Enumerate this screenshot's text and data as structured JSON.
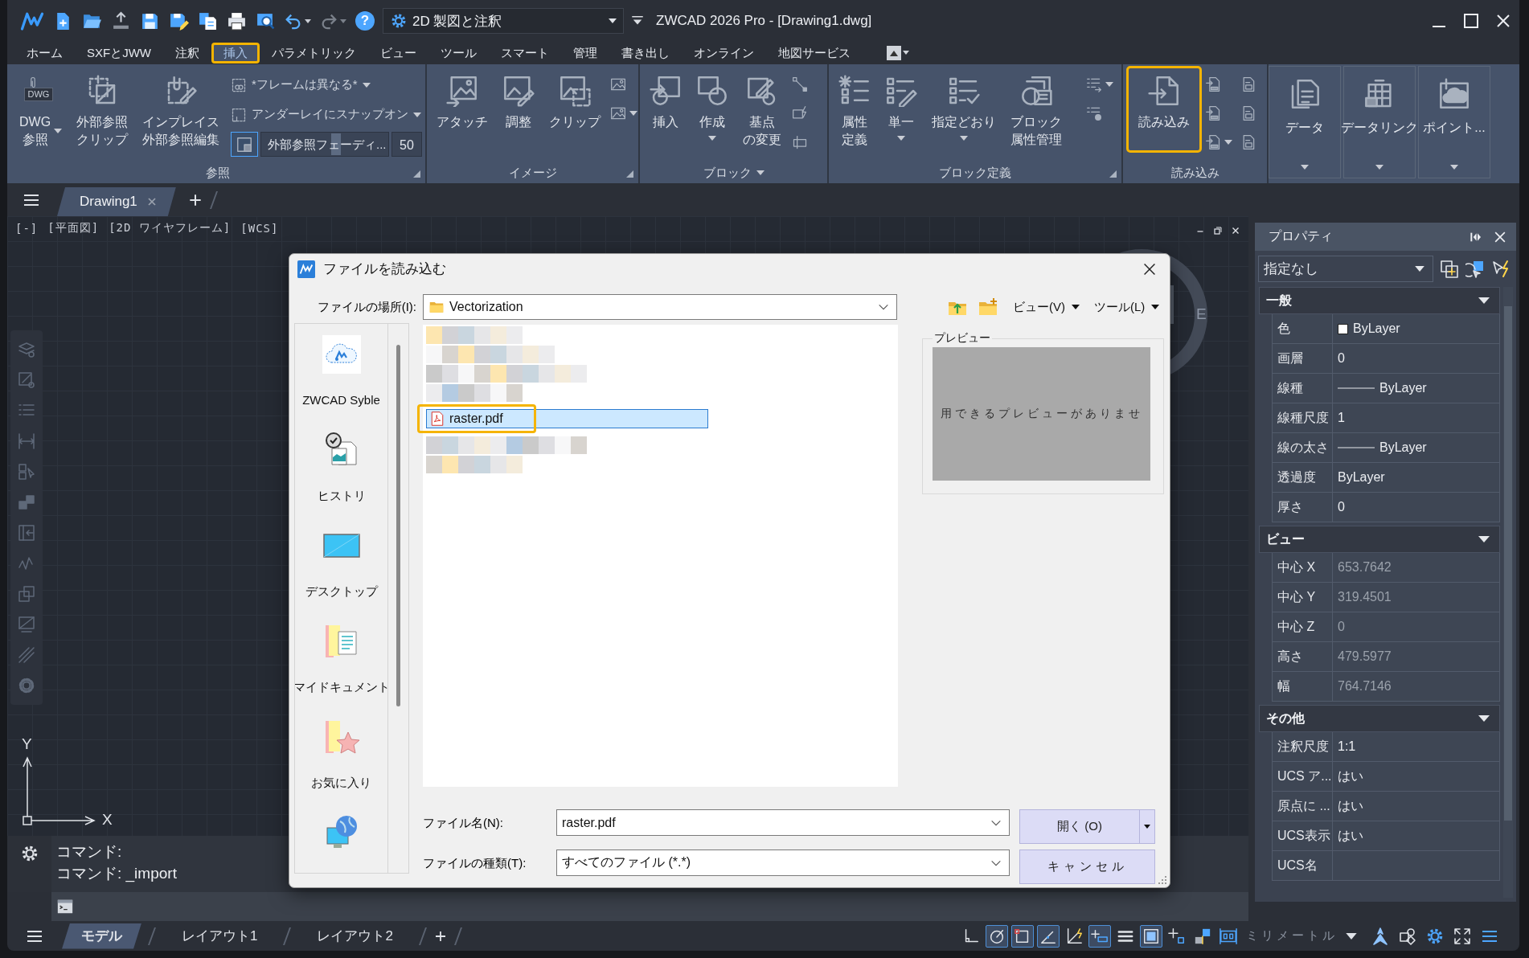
{
  "title_bar": {
    "help": "?",
    "workspace": "2D 製図と注釈",
    "title": "ZWCAD 2026 Pro - [Drawing1.dwg]"
  },
  "menu_tabs": [
    {
      "label": "ホーム",
      "selected": false,
      "highlighted": false
    },
    {
      "label": "SXFとJWW",
      "selected": false,
      "highlighted": false
    },
    {
      "label": "注釈",
      "selected": false,
      "highlighted": false
    },
    {
      "label": "挿入",
      "selected": true,
      "highlighted": true
    },
    {
      "label": "パラメトリック",
      "selected": false,
      "highlighted": false
    },
    {
      "label": "ビュー",
      "selected": false,
      "highlighted": false
    },
    {
      "label": "ツール",
      "selected": false,
      "highlighted": false
    },
    {
      "label": "スマート",
      "selected": false,
      "highlighted": false
    },
    {
      "label": "管理",
      "selected": false,
      "highlighted": false
    },
    {
      "label": "書き出し",
      "selected": false,
      "highlighted": false
    },
    {
      "label": "オンライン",
      "selected": false,
      "highlighted": false
    },
    {
      "label": "地図サービス",
      "selected": false,
      "highlighted": false
    }
  ],
  "ribbon": {
    "panels": [
      {
        "kind": "full",
        "title": "参照",
        "launcher": true,
        "dropdown": false,
        "large_buttons": [
          {
            "lines": [
              "DWG",
              "参照"
            ],
            "badge": "DWG",
            "dropdown": true,
            "highlighted": false
          },
          {
            "lines": [
              "外部参照",
              "クリップ"
            ],
            "dropdown": false,
            "highlighted": false
          },
          {
            "lines": [
              "インプレイス",
              "外部参照編集"
            ],
            "dropdown": false,
            "highlighted": false
          }
        ],
        "small_rows": [
          {
            "kind": "dropdown",
            "label": "*フレームは異なる*"
          },
          {
            "kind": "dropdown",
            "label": "アンダーレイにスナップオン"
          },
          {
            "kind": "fade",
            "on": true,
            "label": "外部参照フェーディ...",
            "level": 0.55,
            "value": "50"
          }
        ]
      },
      {
        "kind": "full",
        "title": "イメージ",
        "launcher": true,
        "dropdown": false,
        "large_buttons": [
          {
            "lines": [
              "アタッチ"
            ],
            "dropdown": false,
            "highlighted": false
          },
          {
            "lines": [
              "調整"
            ],
            "dropdown": false,
            "highlighted": false
          },
          {
            "lines": [
              "クリップ"
            ],
            "dropdown": false,
            "highlighted": false
          }
        ],
        "tools": [
          {
            "dropdown": false
          },
          {
            "dropdown": true
          }
        ]
      },
      {
        "kind": "full",
        "title": "ブロック",
        "launcher": false,
        "dropdown": true,
        "large_buttons": [
          {
            "lines": [
              "挿入"
            ],
            "dropdown": false,
            "highlighted": false
          },
          {
            "lines": [
              "作成"
            ],
            "dropdown": true,
            "highlighted": false
          },
          {
            "lines": [
              "基点",
              "の変更"
            ],
            "dropdown": false,
            "highlighted": false
          }
        ],
        "tools": [
          {
            "dropdown": false
          },
          {
            "dropdown": false
          },
          {
            "dropdown": false
          }
        ]
      },
      {
        "kind": "full",
        "title": "ブロック定義",
        "launcher": true,
        "dropdown": false,
        "large_buttons": [
          {
            "lines": [
              "属性",
              "定義"
            ],
            "dropdown": false,
            "highlighted": false
          },
          {
            "lines": [
              "単一"
            ],
            "dropdown": true,
            "highlighted": false
          },
          {
            "lines": [
              "指定どおり"
            ],
            "dropdown": true,
            "highlighted": false
          },
          {
            "lines": [
              "ブロック",
              "属性管理"
            ],
            "dropdown": false,
            "highlighted": false
          }
        ],
        "tools": [
          {
            "dropdown": true
          },
          {
            "dropdown": false
          }
        ]
      },
      {
        "kind": "full",
        "title": "読み込み",
        "launcher": false,
        "dropdown": false,
        "large_buttons": [
          {
            "lines": [
              "読み込み"
            ],
            "dropdown": false,
            "highlighted": true
          }
        ],
        "tools": [
          {
            "dropdown": false
          },
          {
            "dropdown": false
          },
          {
            "dropdown": true
          },
          {
            "dropdown": false
          },
          {
            "dropdown": false
          },
          {
            "dropdown": false
          }
        ]
      },
      {
        "kind": "collapsed",
        "label": "データ"
      },
      {
        "kind": "collapsed",
        "label": "データリンク"
      },
      {
        "kind": "collapsed",
        "label": "ポイント..."
      }
    ]
  },
  "document_tabs": [
    {
      "label": "Drawing1",
      "selected": true
    }
  ],
  "viewport": {
    "controls": [
      "[-]",
      "[平面図]",
      "[2D ワイヤフレーム]",
      "[WCS]"
    ],
    "viewcube_label": "E",
    "axis_y": "Y",
    "axis_x": "X"
  },
  "command_line": {
    "history": [
      "コマンド:",
      "コマンド: _import"
    ]
  },
  "dialog": {
    "title": "ファイルを読み込む",
    "location_label": "ファイルの場所(I):",
    "location": "Vectorization",
    "view_menu": "ビュー(V)",
    "tools_menu": "ツール(L)",
    "places": [
      {
        "label": "ZWCAD Syble"
      },
      {
        "label": "ヒストリ"
      },
      {
        "label": "デスクトップ"
      },
      {
        "label": "マイドキュメント"
      },
      {
        "label": "お気に入り"
      }
    ],
    "files": [
      {
        "kind": "blurred",
        "selected": false,
        "highlighted": false
      },
      {
        "kind": "blurred",
        "selected": false,
        "highlighted": false
      },
      {
        "kind": "blurred",
        "selected": false,
        "highlighted": false
      },
      {
        "kind": "blurred",
        "selected": false,
        "highlighted": false
      },
      {
        "kind": "file",
        "name": "raster.pdf",
        "selected": true,
        "highlighted": true
      },
      {
        "kind": "blurred",
        "selected": false,
        "highlighted": false
      },
      {
        "kind": "blurred",
        "selected": false,
        "highlighted": false
      }
    ],
    "preview_label": "プレビュー",
    "preview_message": "用できるプレビューがありませ",
    "file_name_label": "ファイル名(N):",
    "file_name": "raster.pdf",
    "file_type_label": "ファイルの種類(T):",
    "file_type": "すべてのファイル (*.*)",
    "open_button": "開く (O)",
    "cancel_button": "キャンセル"
  },
  "properties": {
    "title": "プロパティ",
    "selection": "指定なし",
    "sections": [
      {
        "title": "一般",
        "expanded": true,
        "rows": [
          {
            "kind": "swatch",
            "label": "色",
            "value": "ByLayer",
            "color": "#ffffff",
            "disabled": false
          },
          {
            "kind": "text",
            "label": "画層",
            "value": "0",
            "disabled": false
          },
          {
            "kind": "line",
            "label": "線種",
            "value": "ByLayer",
            "disabled": false
          },
          {
            "kind": "text",
            "label": "線種尺度",
            "value": "1",
            "disabled": false
          },
          {
            "kind": "line",
            "label": "線の太さ",
            "value": "ByLayer",
            "disabled": false
          },
          {
            "kind": "text",
            "label": "透過度",
            "value": "ByLayer",
            "disabled": false
          },
          {
            "kind": "text",
            "label": "厚さ",
            "value": "0",
            "disabled": false
          }
        ]
      },
      {
        "title": "ビュー",
        "expanded": true,
        "rows": [
          {
            "kind": "text",
            "label": "中心 X",
            "value": "653.7642",
            "disabled": true
          },
          {
            "kind": "text",
            "label": "中心 Y",
            "value": "319.4501",
            "disabled": true
          },
          {
            "kind": "text",
            "label": "中心 Z",
            "value": "0",
            "disabled": true
          },
          {
            "kind": "text",
            "label": "高さ",
            "value": "479.5977",
            "disabled": true
          },
          {
            "kind": "text",
            "label": "幅",
            "value": "764.7146",
            "disabled": true
          }
        ]
      },
      {
        "title": "その他",
        "expanded": true,
        "rows": [
          {
            "kind": "text",
            "label": "注釈尺度",
            "value": "1:1",
            "disabled": false
          },
          {
            "kind": "text",
            "label": "UCS ア...",
            "value": "はい",
            "disabled": false
          },
          {
            "kind": "text",
            "label": "原点に ...",
            "value": "はい",
            "disabled": false
          },
          {
            "kind": "text",
            "label": "UCS表示",
            "value": "はい",
            "disabled": false
          },
          {
            "kind": "text",
            "label": "UCS名",
            "disabled": false
          }
        ]
      }
    ]
  },
  "status_bar": {
    "layout_tabs": [
      {
        "label": "モデル",
        "selected": true
      },
      {
        "label": "レイアウト1",
        "selected": false
      },
      {
        "label": "レイアウト2",
        "selected": false
      }
    ],
    "toggles": [
      {
        "on": false
      },
      {
        "on": true
      },
      {
        "on": true
      },
      {
        "on": true
      },
      {
        "on": false
      },
      {
        "on": true
      },
      {
        "on": false
      },
      {
        "on": true
      },
      {
        "on": false
      },
      {
        "on": false
      },
      {
        "on": false
      }
    ],
    "units": "ミリメートル"
  }
}
